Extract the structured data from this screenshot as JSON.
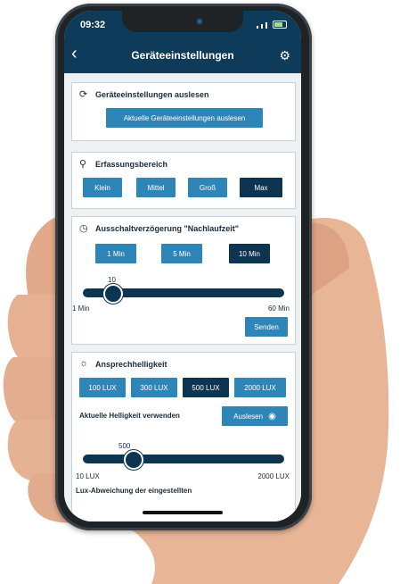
{
  "status": {
    "time": "09:32"
  },
  "header": {
    "title": "Geräteeinstellungen",
    "back_icon": "chevron-left-icon",
    "settings_icon": "gear-icon"
  },
  "read_section": {
    "title": "Geräteeinstellungen auslesen",
    "button": "Aktuelle Geräteeinstellungen auslesen"
  },
  "range_section": {
    "title": "Erfassungsbereich",
    "options": [
      "Klein",
      "Mittel",
      "Groß",
      "Max"
    ],
    "selected": "Max"
  },
  "delay_section": {
    "title": "Ausschaltverzögerung \"Nachlaufzeit\"",
    "options": [
      "1 Min",
      "5 Min",
      "10 Min"
    ],
    "selected": "10 Min",
    "slider_value": "10",
    "slider_fraction": 0.15,
    "min_label": "1 Min",
    "max_label": "60 Min",
    "send_button": "Senden"
  },
  "brightness_section": {
    "title": "Ansprechhelligkeit",
    "options": [
      "100 LUX",
      "300 LUX",
      "500 LUX",
      "2000 LUX"
    ],
    "selected": "500 LUX",
    "current_label": "Aktuelle Helligkeit verwenden",
    "read_button": "Auslesen",
    "slider_value": "500",
    "slider_fraction": 0.25,
    "min_label": "10 LUX",
    "max_label": "2000 LUX",
    "footer_text": "Lux-Abweichung der eingestellten"
  },
  "colors": {
    "header": "#0f3b5a",
    "button": "#2e86b8",
    "selected": "#0d3450"
  }
}
